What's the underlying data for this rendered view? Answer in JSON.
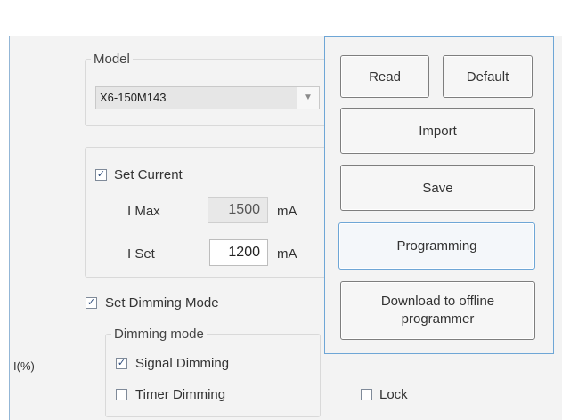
{
  "model": {
    "legend": "Model",
    "selected": "X6-150M143"
  },
  "current": {
    "set_current_label": "Set Current",
    "set_current_checked": true,
    "imax_label": "I Max",
    "imax_value": "1500",
    "imax_unit": "mA",
    "iset_label": "I Set",
    "iset_value": "1200",
    "iset_unit": "mA"
  },
  "dimming": {
    "set_dimming_label": "Set Dimming Mode",
    "set_dimming_checked": true,
    "legend": "Dimming mode",
    "signal_label": "Signal Dimming",
    "signal_checked": true,
    "timer_label": "Timer Dimming",
    "timer_checked": false
  },
  "side_label": "I(%)",
  "lock": {
    "label": "Lock",
    "checked": false
  },
  "buttons": {
    "read": "Read",
    "default": "Default",
    "import": "Import",
    "save": "Save",
    "programming": "Programming",
    "download_line1": "Download to offline",
    "download_line2": "programmer"
  },
  "icons": {
    "check": "✓",
    "dropdown": "▼"
  },
  "colors": {
    "panel_border": "#6ea6d6",
    "background": "#f3f3f3"
  }
}
